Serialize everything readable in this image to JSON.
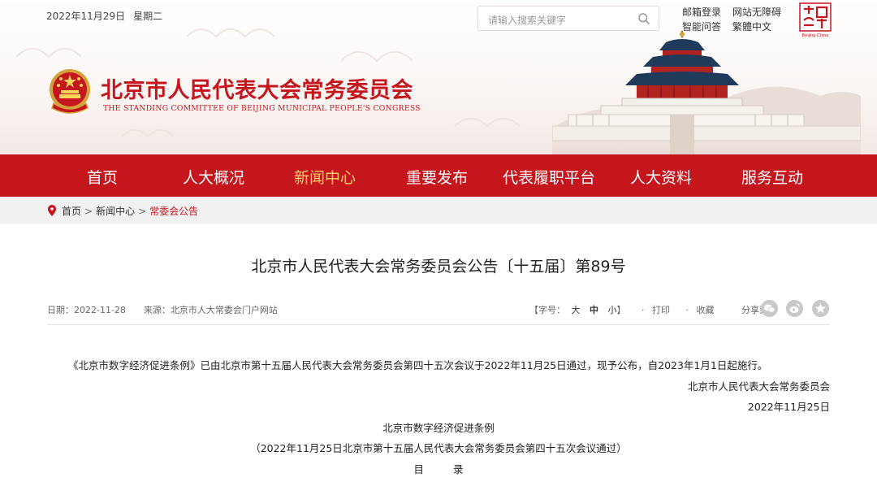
{
  "header": {
    "date": "2022年11月29日",
    "weekday": "星期二",
    "search_placeholder": "请输入搜索关键字",
    "links_row1": [
      "邮箱登录",
      "网站无障碍"
    ],
    "links_row2": [
      "智能问答",
      "繁體中文"
    ],
    "beijing_logo_text": "Beijing·China",
    "site_title": "北京市人民代表大会常务委员会",
    "site_title_en": "THE STANDING COMMITTEE OF BEIJING MUNICIPAL PEOPLE'S CONGRESS"
  },
  "nav": {
    "items": [
      "首页",
      "人大概况",
      "新闻中心",
      "重要发布",
      "代表履职平台",
      "人大资料",
      "服务互动"
    ],
    "active": "新闻中心"
  },
  "breadcrumb": {
    "items": [
      "首页",
      "新闻中心",
      "常委会公告"
    ],
    "separator": ">"
  },
  "article": {
    "title": "北京市人民代表大会常务委员会公告〔十五届〕第89号",
    "date_label": "日期：",
    "date": "2022-11-28",
    "source_label": "来源：",
    "source": "北京市人大常委会门户网站",
    "font_label": "【字号：",
    "font_sizes": [
      "大",
      "中",
      "小"
    ],
    "font_close": "】",
    "print": "打印",
    "favorite": "收藏",
    "share_label": "分享到：",
    "share_icons": [
      "wechat-icon",
      "weibo-icon",
      "qzone-icon"
    ],
    "paragraph": "《北京市数字经济促进条例》已由北京市第十五届人民代表大会常务委员会第四十五次会议于2022年11月25日通过，现予公布，自2023年1月1日起施行。",
    "sign_org": "北京市人民代表大会常务委员会",
    "sign_date": "2022年11月25日",
    "law_title": "北京市数字经济促进条例",
    "law_note": "（2022年11月25日北京市第十五届人民代表大会常务委员会第四十五次会议通过）",
    "toc": "目录"
  },
  "colors": {
    "brand_red": "#c6161d",
    "nav_active": "#f7d36a",
    "breadcrumb_bg": "#f1f1f1"
  }
}
